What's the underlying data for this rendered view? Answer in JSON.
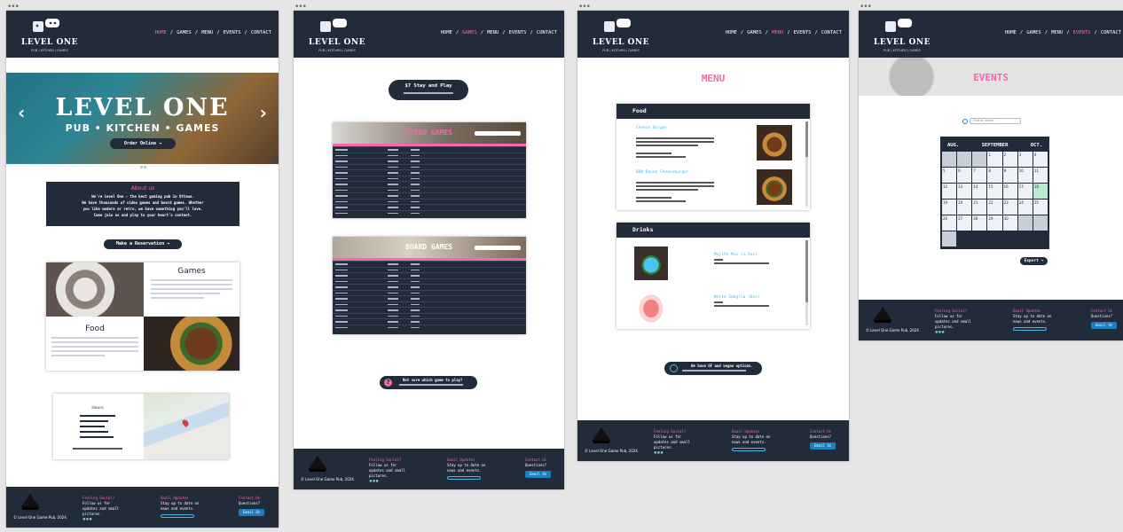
{
  "nav": {
    "home": "HOME",
    "games": "GAMES",
    "menu": "MENU",
    "events": "EVENTS",
    "contact": "CONTACT",
    "sep": "/"
  },
  "brand": {
    "name": "LEVEL ONE",
    "tagline": "PUB | KITCHEN | GAMES"
  },
  "home": {
    "hero_title": "LEVEL ONE",
    "hero_sub": "PUB • KITCHEN • GAMES",
    "hero_cta": "Order Online",
    "prev": "‹",
    "next": "›",
    "about_title": "About us",
    "about_lines": [
      "We're Level One - the best gaming pub in Ottawa.",
      "We have thousands of video games and board games. Whether",
      "you like modern or retro, we have something you'll love.",
      "Come join us and play to your heart's content."
    ],
    "reserve_btn": "Make a Reservation",
    "games_title": "Games",
    "food_title": "Food",
    "hours_title": "Hours"
  },
  "games_page": {
    "pill": "$7 Stay and Play",
    "video": "VIDEO GAMES",
    "board": "BOARD GAMES",
    "help": "Not sure which game to play?"
  },
  "menu_page": {
    "title": "MENU",
    "food": "Food",
    "drinks": "Drinks",
    "items": [
      "Cheese Burger",
      "BBQ Bacon Cheeseburger"
    ],
    "drink_items": [
      "Mojito Mix (1.5oz)",
      "White Sangria (6oz)"
    ],
    "vegan": "We have GF and vegan options."
  },
  "events_page": {
    "title": "EVENTS",
    "search": "Find an event",
    "prev_month": "AUG.",
    "month": "SEPTEMBER",
    "next_month": "OCT.",
    "export": "Export",
    "days": [
      "",
      "",
      "",
      "1",
      "2",
      "3",
      "4",
      "5",
      "6",
      "7",
      "8",
      "9",
      "10",
      "11",
      "12",
      "13",
      "14",
      "15",
      "16",
      "17",
      "18",
      "19",
      "20",
      "21",
      "22",
      "23",
      "24",
      "25",
      "26",
      "27",
      "28",
      "29",
      "30",
      "",
      "",
      ""
    ]
  },
  "footer": {
    "copyright": "© Level One Game Pub, 2024.",
    "c1_title": "Feeling Social?",
    "c1_text": "Follow us for updates and small pictures.",
    "c2_title": "Email Updates",
    "c2_text": "Stay up to date on news and events.",
    "c3_title": "Contact Us",
    "c3_text": "Questions?",
    "c3_btn": "Email Us"
  }
}
